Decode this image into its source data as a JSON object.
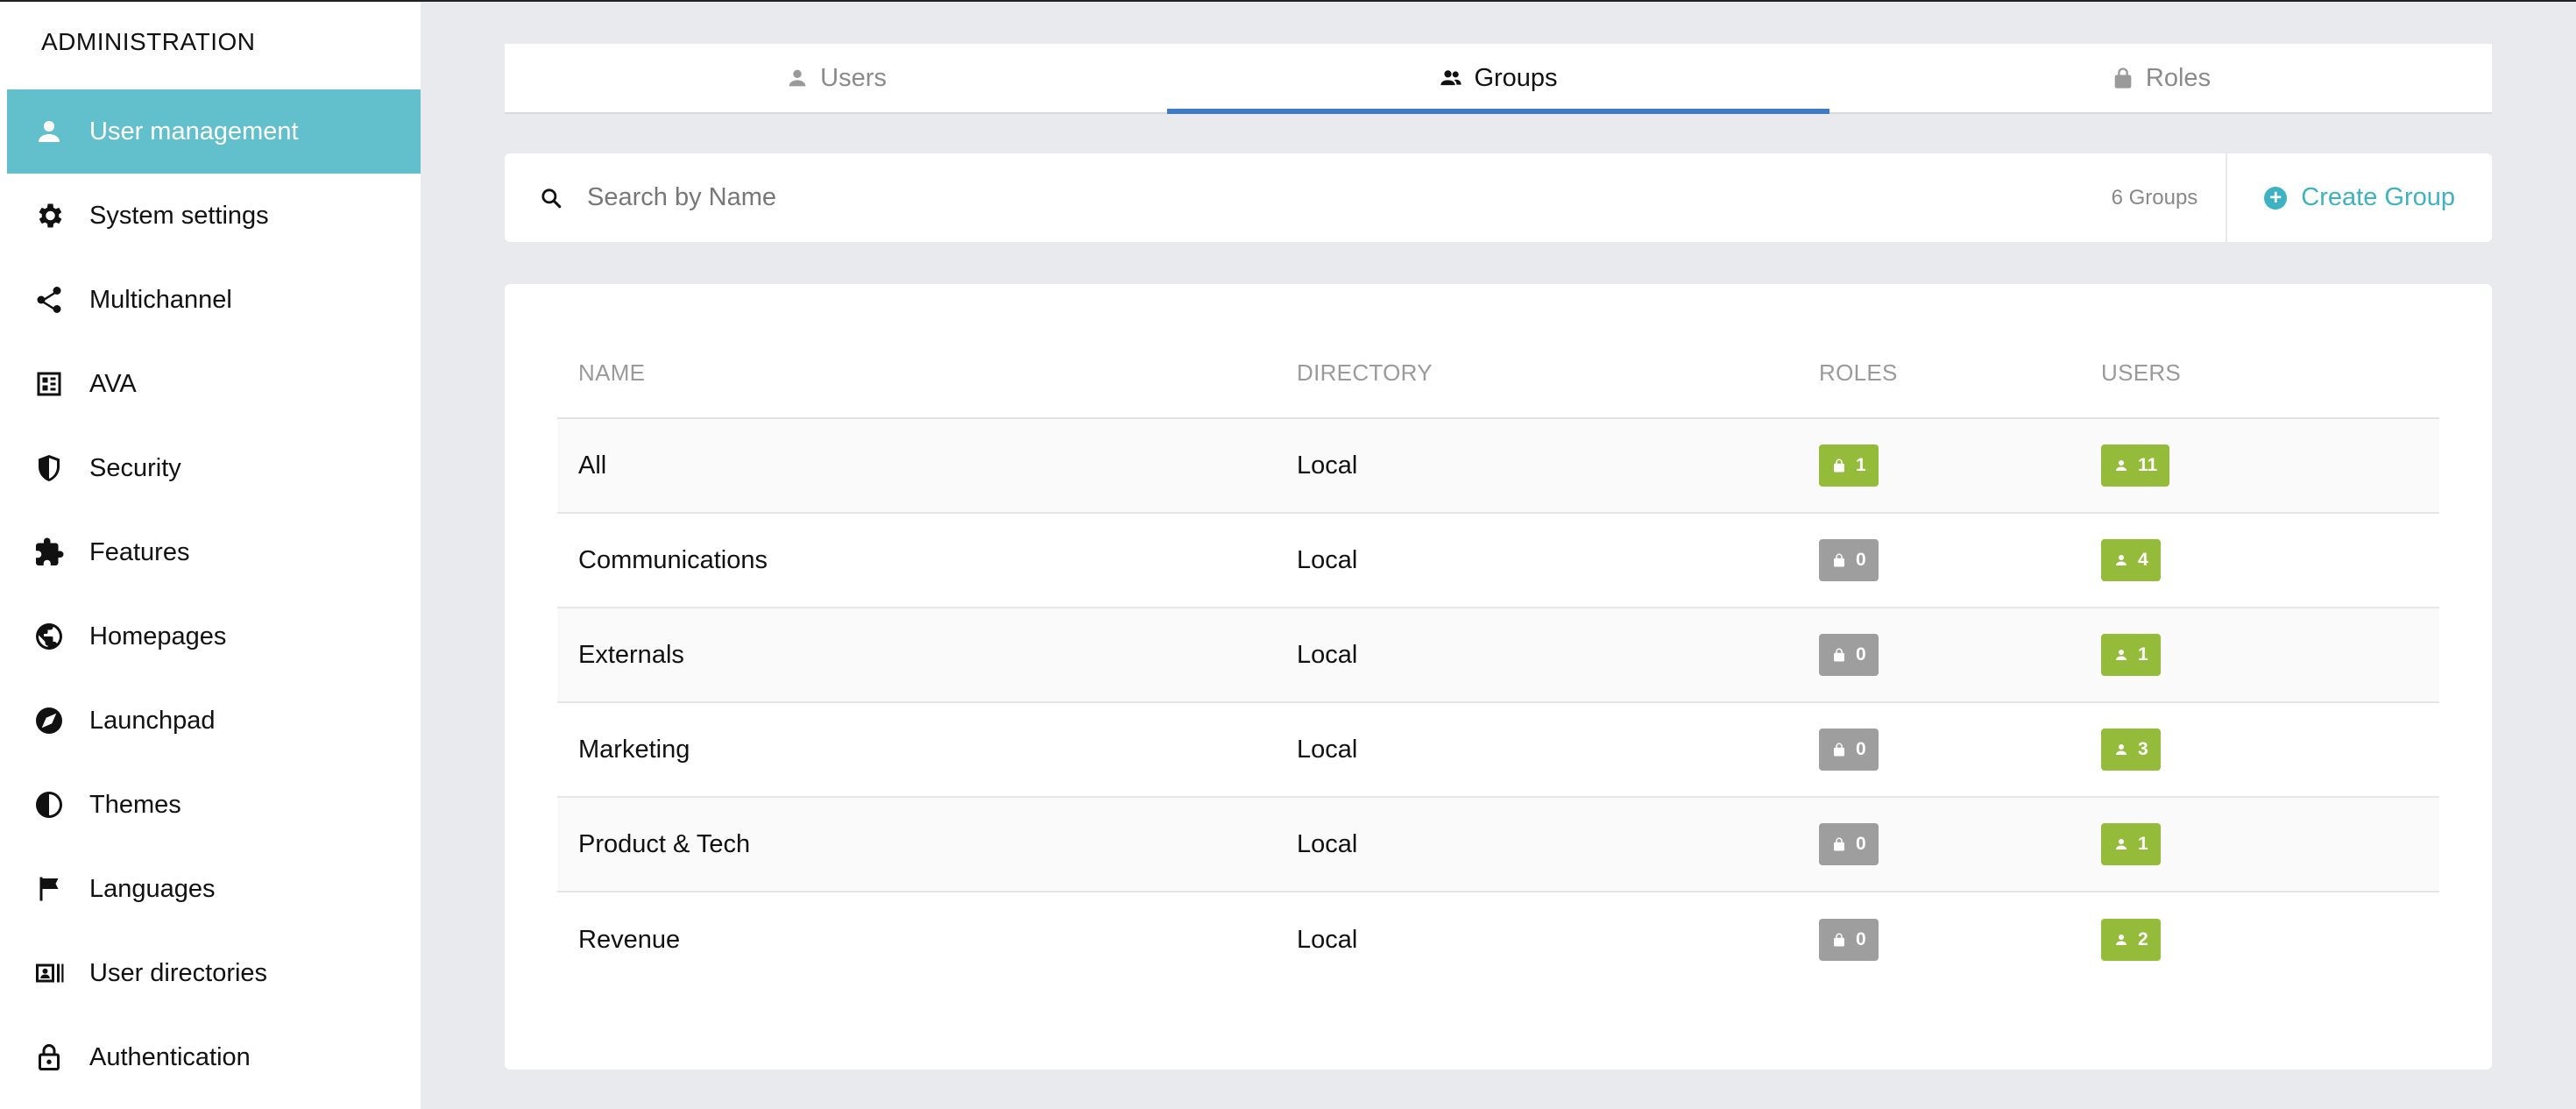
{
  "sidebar": {
    "title": "ADMINISTRATION",
    "items": [
      {
        "label": "User management",
        "icon": "person-icon",
        "active": true
      },
      {
        "label": "System settings",
        "icon": "gear-icon"
      },
      {
        "label": "Multichannel",
        "icon": "share-icon"
      },
      {
        "label": "AVA",
        "icon": "ava-icon"
      },
      {
        "label": "Security",
        "icon": "shield-icon"
      },
      {
        "label": "Features",
        "icon": "puzzle-icon"
      },
      {
        "label": "Homepages",
        "icon": "globe-icon"
      },
      {
        "label": "Launchpad",
        "icon": "compass-icon"
      },
      {
        "label": "Themes",
        "icon": "contrast-icon"
      },
      {
        "label": "Languages",
        "icon": "flag-icon"
      },
      {
        "label": "User directories",
        "icon": "id-card-icon"
      },
      {
        "label": "Authentication",
        "icon": "lock-icon"
      }
    ]
  },
  "tabs": [
    {
      "label": "Users",
      "icon": "person-icon"
    },
    {
      "label": "Groups",
      "icon": "group-icon",
      "active": true
    },
    {
      "label": "Roles",
      "icon": "lock-icon"
    }
  ],
  "search": {
    "placeholder": "Search by Name",
    "count": "6 Groups"
  },
  "create_button": {
    "label": "Create Group"
  },
  "table": {
    "headers": {
      "name": "NAME",
      "directory": "DIRECTORY",
      "roles": "ROLES",
      "users": "USERS"
    },
    "rows": [
      {
        "name": "All",
        "directory": "Local",
        "roles": "1",
        "users": "11",
        "roles_active": true
      },
      {
        "name": "Communications",
        "directory": "Local",
        "roles": "0",
        "users": "4",
        "roles_active": false
      },
      {
        "name": "Externals",
        "directory": "Local",
        "roles": "0",
        "users": "1",
        "roles_active": false
      },
      {
        "name": "Marketing",
        "directory": "Local",
        "roles": "0",
        "users": "3",
        "roles_active": false
      },
      {
        "name": "Product & Tech",
        "directory": "Local",
        "roles": "0",
        "users": "1",
        "roles_active": false
      },
      {
        "name": "Revenue",
        "directory": "Local",
        "roles": "0",
        "users": "2",
        "roles_active": false
      }
    ]
  },
  "colors": {
    "accent": "#62bfcc",
    "tab_underline": "#3f7bc4",
    "badge_green": "#95bb3a",
    "badge_gray": "#9e9e9e",
    "link": "#3eb1c3"
  }
}
